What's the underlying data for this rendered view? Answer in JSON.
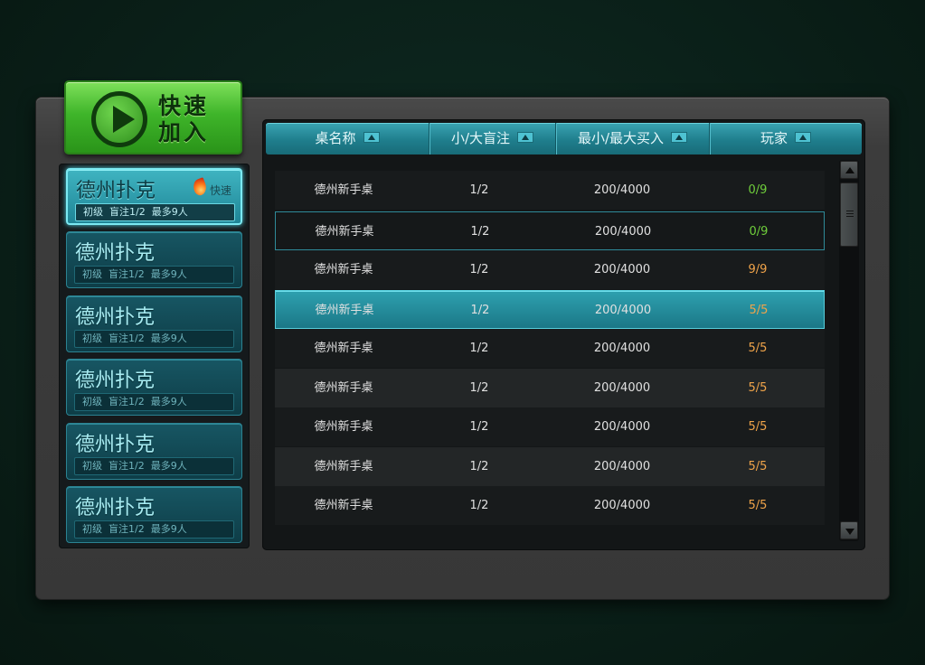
{
  "quick_join": {
    "label": "快速 加入"
  },
  "sidebar": {
    "items": [
      {
        "name": "德州扑克",
        "info": "初级  盲注1/2  最多9人",
        "tag": "快速",
        "active": true
      },
      {
        "name": "德州扑克",
        "info": "初级  盲注1/2  最多9人"
      },
      {
        "name": "德州扑克",
        "info": "初级  盲注1/2  最多9人"
      },
      {
        "name": "德州扑克",
        "info": "初级  盲注1/2  最多9人"
      },
      {
        "name": "德州扑克",
        "info": "初级  盲注1/2  最多9人"
      },
      {
        "name": "德州扑克",
        "info": "初级  盲注1/2  最多9人"
      }
    ]
  },
  "table": {
    "headers": [
      "桌名称",
      "小/大盲注",
      "最小/最大买入",
      "玩家"
    ],
    "rows": [
      {
        "name": "德州新手桌",
        "blinds": "1/2",
        "buyin": "200/4000",
        "players": "0/9",
        "state": "normal"
      },
      {
        "name": "德州新手桌",
        "blinds": "1/2",
        "buyin": "200/4000",
        "players": "0/9",
        "state": "hover"
      },
      {
        "name": "德州新手桌",
        "blinds": "1/2",
        "buyin": "200/4000",
        "players": "9/9",
        "state": "normal"
      },
      {
        "name": "德州新手桌",
        "blinds": "1/2",
        "buyin": "200/4000",
        "players": "5/5",
        "state": "selected"
      },
      {
        "name": "德州新手桌",
        "blinds": "1/2",
        "buyin": "200/4000",
        "players": "5/5",
        "state": "normal"
      },
      {
        "name": "德州新手桌",
        "blinds": "1/2",
        "buyin": "200/4000",
        "players": "5/5",
        "state": "normal"
      },
      {
        "name": "德州新手桌",
        "blinds": "1/2",
        "buyin": "200/4000",
        "players": "5/5",
        "state": "normal"
      },
      {
        "name": "德州新手桌",
        "blinds": "1/2",
        "buyin": "200/4000",
        "players": "5/5",
        "state": "normal"
      },
      {
        "name": "德州新手桌",
        "blinds": "1/2",
        "buyin": "200/4000",
        "players": "5/5",
        "state": "normal"
      }
    ]
  },
  "colors": {
    "accent": "#2ea1b0",
    "player_empty": "#6fce3b",
    "player_full": "#f0a44a",
    "quick_join_green": "#3fb52a"
  }
}
